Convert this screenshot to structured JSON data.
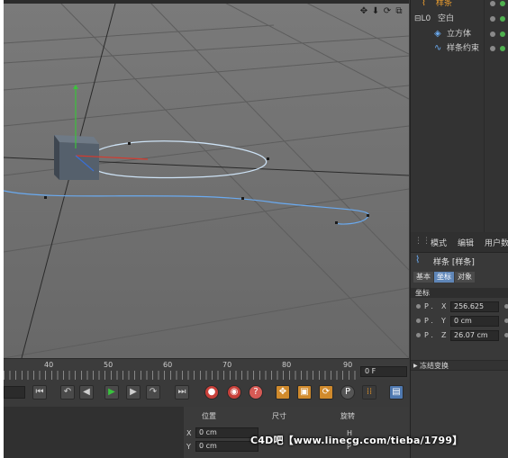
{
  "viewport": {
    "nav_icons": [
      "move-view-icon",
      "zoom-view-icon",
      "rotate-view-icon",
      "maximize-view-icon"
    ]
  },
  "object_manager": {
    "items": [
      {
        "label": "样条",
        "icon": "spline-icon",
        "selected": true
      },
      {
        "label": "空白",
        "icon": "null-object-icon",
        "selected": false
      },
      {
        "label": "立方体",
        "icon": "cube-icon",
        "selected": false
      },
      {
        "label": "样条约束",
        "icon": "spline-wrap-icon",
        "selected": false
      }
    ]
  },
  "attributes": {
    "menu": [
      "模式",
      "编辑",
      "用户数"
    ],
    "title": "样条 [样条]",
    "tabs": [
      "基本",
      "坐标",
      "对象"
    ],
    "active_tab": "坐标",
    "section": "坐标",
    "rows": [
      {
        "p": "P .",
        "axis": "X",
        "value": "256.625"
      },
      {
        "p": "P .",
        "axis": "Y",
        "value": "0 cm"
      },
      {
        "p": "P .",
        "axis": "Z",
        "value": "26.07 cm"
      }
    ],
    "freeze": "冻结变换"
  },
  "timeline": {
    "ticks": [
      "40",
      "50",
      "60",
      "70",
      "80",
      "90"
    ],
    "current_frame": "0 F"
  },
  "transport": {
    "start_field": "",
    "buttons": [
      "go-to-start-icon",
      "prev-key-icon",
      "prev-frame-icon",
      "play-icon",
      "next-frame-icon",
      "next-key-icon",
      "go-to-end-icon",
      "record-icon",
      "autokey-icon",
      "keyframe-selection-icon",
      "move-key-icon",
      "scale-key-icon",
      "rotate-key-icon",
      "param-key-icon",
      "point-level-icon",
      "film-icon"
    ]
  },
  "coordinates": {
    "headers": [
      "位置",
      "尺寸",
      "旋转"
    ],
    "rows": [
      {
        "axis": "X",
        "value": "0 cm",
        "rot": "H"
      },
      {
        "axis": "Y",
        "value": "0 cm",
        "rot": "P"
      }
    ]
  },
  "watermark": "C4D吧【www.linecg.com/tieba/1799】",
  "colors": {
    "viewport_bg": "#6e6e6e",
    "selection_orange": "#f0a030",
    "tab_active": "#5f86b8",
    "spline_blue": "#6aaaf0"
  }
}
